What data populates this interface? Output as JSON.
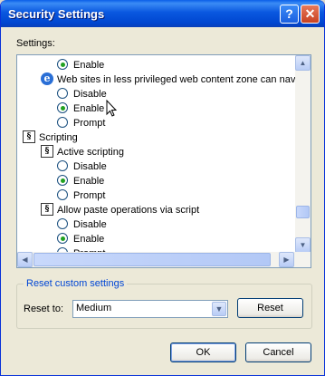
{
  "window": {
    "title": "Security Settings"
  },
  "titlebar_buttons": {
    "help": "?",
    "close": "✕"
  },
  "settings_label": "Settings:",
  "tree": {
    "r0": "Enable",
    "r1": "Web sites in less privileged web content zone can navigate",
    "r2": "Disable",
    "r3": "Enable",
    "r4": "Prompt",
    "r5": "Scripting",
    "r6": "Active scripting",
    "r7": "Disable",
    "r8": "Enable",
    "r9": "Prompt",
    "r10": "Allow paste operations via script",
    "r11": "Disable",
    "r12": "Enable",
    "r13": "Prompt"
  },
  "checked_options": [
    "r0",
    "r3",
    "r8",
    "r12"
  ],
  "reset_group": {
    "title": "Reset custom settings",
    "reset_to_label": "Reset to:",
    "selected_level": "Medium",
    "reset_button": "Reset"
  },
  "buttons": {
    "ok": "OK",
    "cancel": "Cancel"
  },
  "colors": {
    "titlebar": "#0a58e0",
    "window_bg": "#ece9d8",
    "group_title": "#0046d5",
    "radio_dot": "#21a121"
  },
  "icons": [
    "help-icon",
    "close-icon",
    "ie-page-icon",
    "script-icon",
    "scroll-up-icon",
    "scroll-down-icon",
    "scroll-left-icon",
    "scroll-right-icon",
    "dropdown-arrow-icon",
    "mouse-cursor-icon"
  ]
}
